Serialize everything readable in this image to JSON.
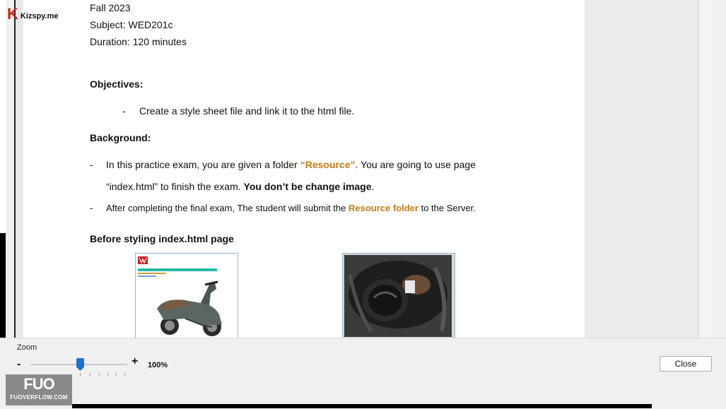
{
  "document": {
    "term": "Fall 2023",
    "subject": "Subject: WED201c",
    "duration": "Duration: 120 minutes",
    "objectives_heading": "Objectives:",
    "objective_bullet_marker": "-",
    "objective_1": "Create a style sheet file and link it to the html file.",
    "background_heading": "Background:",
    "bullet_marker": "-",
    "bg1_part1": "In this practice exam, you are given a folder ",
    "bg1_highlight": "“Resource”",
    "bg1_part2": ". You are going to use page",
    "bg1_line2_part1": "“index.html”  to finish the exam. ",
    "bg1_line2_bold": "You don’t be change image",
    "bg1_line2_end": ".",
    "bg2_part1": "After completing the final exam, The student will submit the ",
    "bg2_highlight": "Resource folder",
    "bg2_part2": " to the Server.",
    "before_heading": "Before styling index.html page"
  },
  "zoom": {
    "label": "Zoom",
    "minus": "-",
    "plus": "+",
    "percent_text": "100%",
    "value_percent": 100
  },
  "buttons": {
    "close": "Close"
  },
  "logos": {
    "kizspy_k": "K",
    "kizspy_text": "Kizspy.me",
    "fuo_big": "FUO",
    "fuo_small": "FUOVERFLOW.COM"
  },
  "colors": {
    "highlight": "#c47a18",
    "slider_thumb": "#1e6fd0",
    "kizspy_red": "#c0271b"
  }
}
